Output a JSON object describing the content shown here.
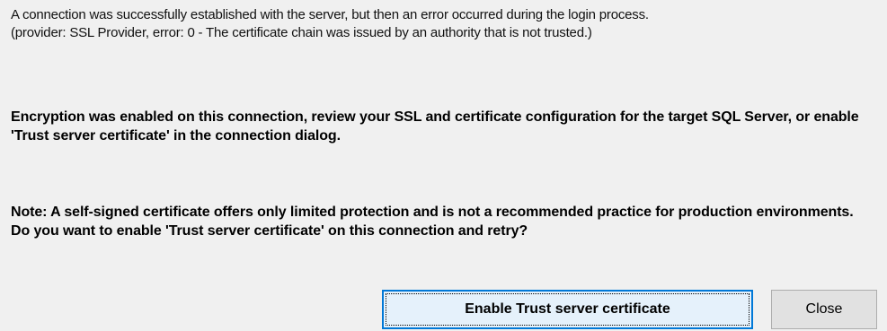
{
  "messages": {
    "error_detail": "A connection was successfully established with the server, but then an error occurred during the login process.\n(provider: SSL Provider, error: 0 - The certificate chain was issued by an authority that is not trusted.)",
    "encryption": "Encryption was enabled on this connection, review your SSL and certificate configuration for the target SQL Server, or enable 'Trust server certificate' in the connection dialog.",
    "note": "Note: A self-signed certificate offers only limited protection and is not a recommended practice for production environments. Do you want to enable 'Trust server certificate' on this connection and retry?"
  },
  "buttons": {
    "enable_trust_label": "Enable Trust server certificate",
    "close_label": "Close"
  },
  "colors": {
    "background": "#f0f0f0",
    "primary_border": "#0078d7",
    "button_face": "#e1e1e1"
  }
}
